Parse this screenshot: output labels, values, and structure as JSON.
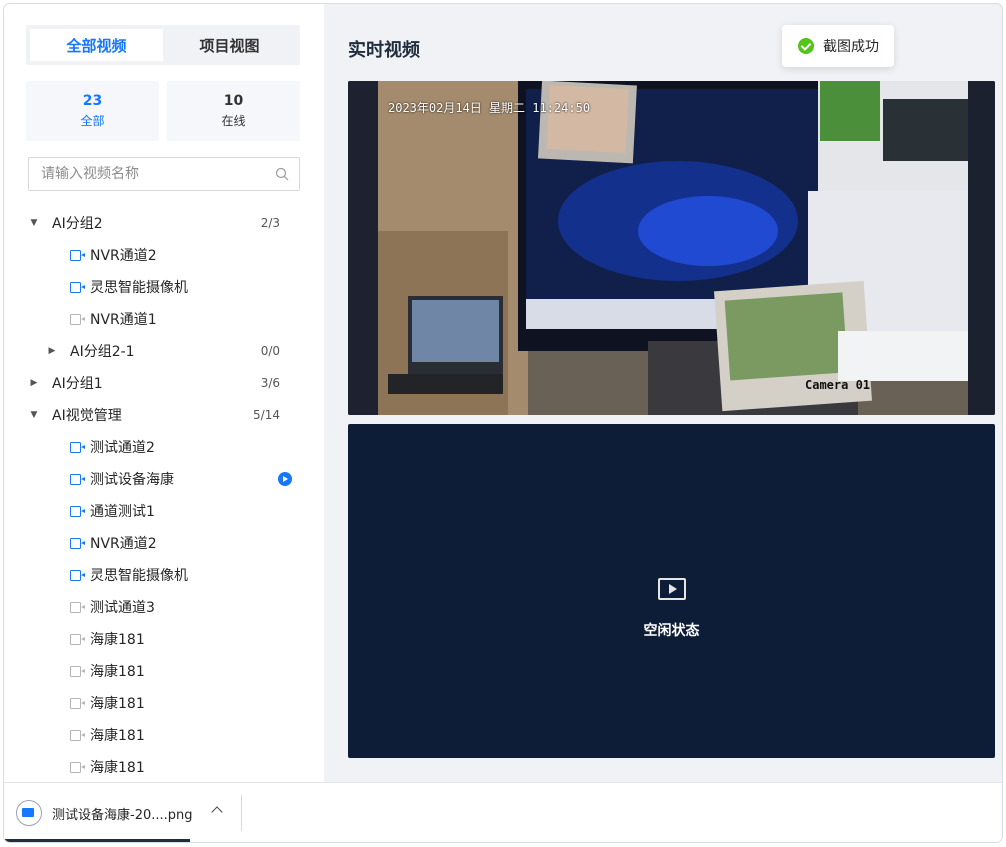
{
  "sidebar": {
    "tabs": [
      {
        "label": "全部视频",
        "active": true
      },
      {
        "label": "项目视图",
        "active": false
      }
    ],
    "stats": [
      {
        "value": "23",
        "label": "全部"
      },
      {
        "value": "10",
        "label": "在线"
      }
    ],
    "search": {
      "placeholder": "请输入视频名称",
      "icon": "search-icon"
    },
    "tree": [
      {
        "type": "group",
        "level": 0,
        "expanded": true,
        "label": "AI分组2",
        "count": "2/3"
      },
      {
        "type": "leaf",
        "online": true,
        "label": "NVR通道2"
      },
      {
        "type": "leaf",
        "online": true,
        "label": "灵思智能摄像机"
      },
      {
        "type": "leaf",
        "online": false,
        "label": "NVR通道1"
      },
      {
        "type": "group",
        "level": 1,
        "expanded": false,
        "label": "AI分组2-1",
        "count": "0/0"
      },
      {
        "type": "group",
        "level": 0,
        "expanded": false,
        "label": "AI分组1",
        "count": "3/6"
      },
      {
        "type": "group",
        "level": 0,
        "expanded": true,
        "label": "AI视觉管理",
        "count": "5/14"
      },
      {
        "type": "leaf",
        "online": true,
        "label": "测试通道2"
      },
      {
        "type": "leaf",
        "online": true,
        "label": "测试设备海康",
        "playing": true
      },
      {
        "type": "leaf",
        "online": true,
        "label": "通道测试1"
      },
      {
        "type": "leaf",
        "online": true,
        "label": "NVR通道2"
      },
      {
        "type": "leaf",
        "online": true,
        "label": "灵思智能摄像机"
      },
      {
        "type": "leaf",
        "online": false,
        "label": "测试通道3"
      },
      {
        "type": "leaf",
        "online": false,
        "label": "海康181"
      },
      {
        "type": "leaf",
        "online": false,
        "label": "海康181"
      },
      {
        "type": "leaf",
        "online": false,
        "label": "海康181"
      },
      {
        "type": "leaf",
        "online": false,
        "label": "海康181"
      },
      {
        "type": "leaf",
        "online": false,
        "label": "海康181"
      }
    ]
  },
  "main": {
    "title": "实时视频",
    "toast": {
      "text": "截图成功",
      "icon": "check-circle-icon",
      "color": "#52c41a"
    },
    "video1": {
      "timestamp": "2023年02月14日 星期二 11:24:50",
      "camera_label": "Camera 01"
    },
    "video2": {
      "status": "空闲状态",
      "icon": "video-play-icon"
    }
  },
  "download_bar": {
    "file_name": "测试设备海康-20....png"
  },
  "colors": {
    "accent": "#1677ff",
    "video_bg": "#0e1d37"
  }
}
